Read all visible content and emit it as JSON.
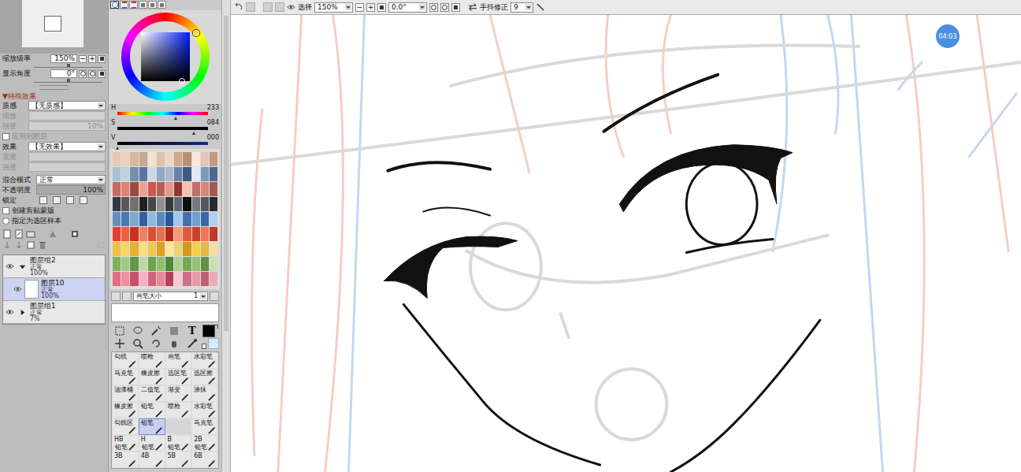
{
  "navigator": {
    "zoom_label": "缩放级率",
    "zoom": "150%",
    "zoom_level": 0.5,
    "angle_label": "显示角度",
    "angle": "0°",
    "angle_level": 0.5,
    "buttons": [
      "−",
      "+"
    ]
  },
  "effects": {
    "header": "▼特殊效果",
    "texture_label": "质感",
    "texture": "【无质感】",
    "texture_params": [
      {
        "label": "缩放",
        "value": "",
        "disabled": true
      },
      {
        "label": "强度",
        "value": "10%",
        "disabled": true
      }
    ],
    "texture_apply": {
      "label": "应用到图层",
      "checked": false,
      "disabled": true
    },
    "effect_label": "效果",
    "effect": "【无效果】",
    "effect_params": [
      {
        "label": "宽度",
        "value": "",
        "disabled": true
      },
      {
        "label": "强度",
        "value": "",
        "disabled": true
      }
    ]
  },
  "layer_props": {
    "blend_label": "混合模式",
    "blend": "正常",
    "opacity_label": "不透明度",
    "opacity": "100%",
    "opacity_level": 1,
    "lock_label": "锁定",
    "clip": {
      "label": "创建剪贴蒙版",
      "checked": false
    },
    "sample": {
      "label": "指定为选区样本",
      "checked": false
    }
  },
  "layers": [
    {
      "name": "图层组2",
      "mode": "正常",
      "opacity": "100%",
      "kind": "group",
      "expanded": true,
      "visible": true,
      "selected": false
    },
    {
      "name": "图层10",
      "mode": "正常",
      "opacity": "100%",
      "kind": "layer",
      "expanded": false,
      "visible": true,
      "selected": true
    },
    {
      "name": "图层组1",
      "mode": "正常",
      "opacity": "7%",
      "kind": "group",
      "expanded": false,
      "visible": true,
      "selected": false
    }
  ],
  "color": {
    "sliders": [
      {
        "label": "H",
        "value": "233",
        "level": 0.647,
        "kind": "hue"
      },
      {
        "label": "S",
        "value": "084",
        "level": 0.84,
        "kind": "sat"
      },
      {
        "label": "V",
        "value": "000",
        "level": 0,
        "kind": "val"
      }
    ],
    "current": "#000000",
    "secondary": "#d6ecf8"
  },
  "swatches": [
    "#e8c8b0",
    "#f0d0c0",
    "#d8b8a0",
    "#c8a890",
    "#f4e0d0",
    "#e0c0a8",
    "#ecd8c8",
    "#d0a890",
    "#b89070",
    "#f8e8e0",
    "#e4c4b4",
    "#c49a80",
    "#a8c0d8",
    "#c0d0e0",
    "#7890b0",
    "#5878a0",
    "#d0d8e8",
    "#90a8c8",
    "#b0b8c8",
    "#6880a8",
    "#405880",
    "#e0e8f0",
    "#8098b8",
    "#506890",
    "#c86860",
    "#e08070",
    "#a04840",
    "#f0a090",
    "#d05850",
    "#b86058",
    "#e89888",
    "#903830",
    "#f8c0b0",
    "#c07068",
    "#d88878",
    "#a85850",
    "#303848",
    "#585858",
    "#707070",
    "#202020",
    "#484848",
    "#909090",
    "#383838",
    "#606878",
    "#101010",
    "#787878",
    "#505860",
    "#282830",
    "#6090c0",
    "#4878b0",
    "#80a8d0",
    "#3060a0",
    "#90b8e0",
    "#5888c0",
    "#2858a0",
    "#a0c8e8",
    "#4070b0",
    "#70a0d0",
    "#3868a8",
    "#b0d0f0",
    "#e04030",
    "#f06040",
    "#c83020",
    "#f08060",
    "#d85038",
    "#e87050",
    "#b82818",
    "#f89878",
    "#e05840",
    "#d04028",
    "#f07858",
    "#c03828",
    "#f0c040",
    "#f8d860",
    "#e8b030",
    "#f8e080",
    "#f0c850",
    "#e0a020",
    "#f8e898",
    "#f0d070",
    "#d89818",
    "#f8d048",
    "#e8b840",
    "#f0e0a0",
    "#80b060",
    "#a0c880",
    "#609848",
    "#c0d8a0",
    "#70a050",
    "#90c070",
    "#508838",
    "#b0d090",
    "#78a858",
    "#98c078",
    "#688f48",
    "#c8e0b0",
    "#e07080",
    "#f090a0",
    "#c85068",
    "#f8b0c0",
    "#d86078",
    "#e88898",
    "#b84058",
    "#f8c8d0",
    "#d07088",
    "#e898a8",
    "#c06078",
    "#f0a8b8"
  ],
  "brush_size": {
    "label": "画笔大小",
    "value": "1"
  },
  "text_tool": "T",
  "brushes": [
    {
      "tag": "",
      "name": "勾线",
      "kind": "brush",
      "selected": false
    },
    {
      "tag": "",
      "name": "喷枪",
      "kind": "brush",
      "selected": false
    },
    {
      "tag": "",
      "name": "画笔",
      "kind": "brush",
      "selected": false
    },
    {
      "tag": "",
      "name": "水彩笔",
      "kind": "brush",
      "selected": false
    },
    {
      "tag": "",
      "name": "马克笔",
      "kind": "brush",
      "selected": false
    },
    {
      "tag": "",
      "name": "橡皮擦",
      "kind": "brush",
      "selected": false
    },
    {
      "tag": "",
      "name": "选区笔",
      "kind": "brush",
      "selected": false
    },
    {
      "tag": "",
      "name": "选区擦",
      "kind": "brush",
      "selected": false
    },
    {
      "tag": "",
      "name": "油漆桶",
      "kind": "brush",
      "selected": false
    },
    {
      "tag": "",
      "name": "二值笔",
      "kind": "brush",
      "selected": false
    },
    {
      "tag": "",
      "name": "渐变",
      "kind": "brush",
      "selected": false
    },
    {
      "tag": "",
      "name": "涂抹",
      "kind": "brush",
      "selected": false
    },
    {
      "tag": "",
      "name": "橡皮擦",
      "kind": "brush",
      "selected": false
    },
    {
      "tag": "",
      "name": "铅笔",
      "kind": "brush",
      "selected": false
    },
    {
      "tag": "",
      "name": "喷枪",
      "kind": "brush",
      "selected": false
    },
    {
      "tag": "",
      "name": "水彩笔",
      "kind": "brush",
      "selected": false
    },
    {
      "tag": "",
      "name": "勾线区",
      "kind": "brush",
      "selected": false
    },
    {
      "tag": "",
      "name": "铅笔",
      "kind": "brush",
      "selected": true
    },
    {
      "tag": "",
      "name": "",
      "kind": "empty",
      "selected": false
    },
    {
      "tag": "",
      "name": "马克笔",
      "kind": "brush",
      "selected": false
    },
    {
      "tag": "HB",
      "name": "铅笔",
      "kind": "brush",
      "selected": false
    },
    {
      "tag": "H",
      "name": "铅笔",
      "kind": "brush",
      "selected": false
    },
    {
      "tag": "B",
      "name": "铅笔",
      "kind": "brush",
      "selected": false
    },
    {
      "tag": "2B",
      "name": "铅笔",
      "kind": "brush",
      "selected": false
    },
    {
      "tag": "3B",
      "name": "",
      "kind": "brush",
      "selected": false
    },
    {
      "tag": "4B",
      "name": "",
      "kind": "brush",
      "selected": false
    },
    {
      "tag": "5B",
      "name": "",
      "kind": "brush",
      "selected": false
    },
    {
      "tag": "6B",
      "name": "",
      "kind": "brush",
      "selected": false
    }
  ],
  "toolbar": {
    "select_label": "选择",
    "select_checked": true,
    "zoom": "150%",
    "zoom_buttons": [
      "−",
      "+"
    ],
    "angle": "0.0°",
    "stabilizer_label": "手抖修正",
    "stabilizer": "9"
  },
  "badge": "04:03"
}
